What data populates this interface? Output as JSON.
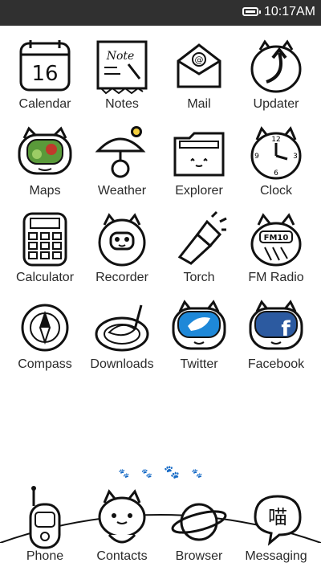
{
  "status_bar": {
    "time": "10:17AM",
    "battery_icon": "battery-icon"
  },
  "apps": [
    {
      "label": "Calendar",
      "icon": "calendar-icon",
      "number": "16"
    },
    {
      "label": "Notes",
      "icon": "notes-icon",
      "note_text": "Note"
    },
    {
      "label": "Mail",
      "icon": "mail-icon"
    },
    {
      "label": "Updater",
      "icon": "updater-icon"
    },
    {
      "label": "Maps",
      "icon": "maps-icon"
    },
    {
      "label": "Weather",
      "icon": "weather-icon"
    },
    {
      "label": "Explorer",
      "icon": "explorer-icon"
    },
    {
      "label": "Clock",
      "icon": "clock-icon",
      "numbers": [
        "12",
        "3",
        "6",
        "9"
      ]
    },
    {
      "label": "Calculator",
      "icon": "calculator-icon"
    },
    {
      "label": "Recorder",
      "icon": "recorder-icon"
    },
    {
      "label": "Torch",
      "icon": "torch-icon"
    },
    {
      "label": "FM Radio",
      "icon": "fm-radio-icon",
      "tag": "FM10"
    },
    {
      "label": "Compass",
      "icon": "compass-icon"
    },
    {
      "label": "Downloads",
      "icon": "downloads-icon"
    },
    {
      "label": "Twitter",
      "icon": "twitter-icon"
    },
    {
      "label": "Facebook",
      "icon": "facebook-icon"
    }
  ],
  "page_indicator": {
    "pages": 4,
    "active": 3
  },
  "dock": [
    {
      "label": "Phone",
      "icon": "phone-icon"
    },
    {
      "label": "Contacts",
      "icon": "contacts-icon"
    },
    {
      "label": "Browser",
      "icon": "browser-icon"
    },
    {
      "label": "Messaging",
      "icon": "messaging-icon",
      "glyph": "喵"
    }
  ],
  "colors": {
    "status_bar": "#303030",
    "twitter": "#1e88d8",
    "facebook": "#2c5aa0",
    "maps_green": "#5a9a3a",
    "maps_red": "#c0392b"
  }
}
